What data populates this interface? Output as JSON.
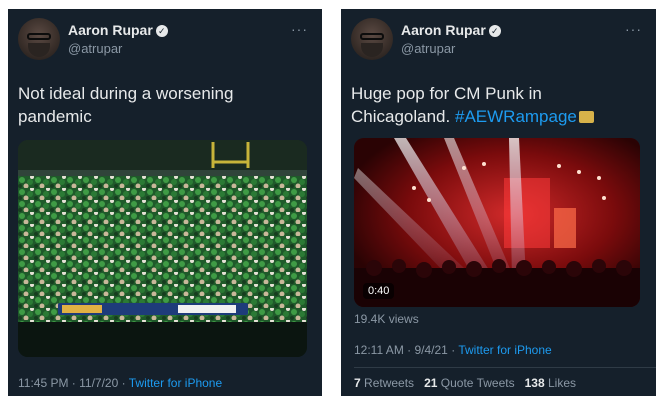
{
  "tweets": [
    {
      "author": "Aaron Rupar",
      "handle": "@atrupar",
      "text": "Not ideal during a worsening pandemic",
      "media": {
        "type": "image",
        "alt_icon": "photo"
      },
      "time": "11:45 PM · 11/7/20",
      "source": "Twitter for iPhone"
    },
    {
      "author": "Aaron Rupar",
      "handle": "@atrupar",
      "text": "Huge pop for CM Punk in Chicagoland.",
      "hashtag": "#AEWRampage",
      "media": {
        "type": "video",
        "duration": "0:40"
      },
      "views": "19.4K views",
      "time": "12:11 AM · 9/4/21",
      "source": "Twitter for iPhone",
      "stats": {
        "retweets_count": "7",
        "retweets_label": "Retweets",
        "quotes_count": "21",
        "quotes_label": "Quote Tweets",
        "likes_count": "138",
        "likes_label": "Likes"
      }
    }
  ],
  "icons": {
    "verified": "verified-badge-icon",
    "more": "more-options-icon",
    "hashtag_emoji": "aew-hashflag-icon"
  },
  "colors": {
    "background": "#15202b",
    "text": "#e7e9ea",
    "muted": "#8b98a5",
    "link": "#1d9bf0"
  }
}
